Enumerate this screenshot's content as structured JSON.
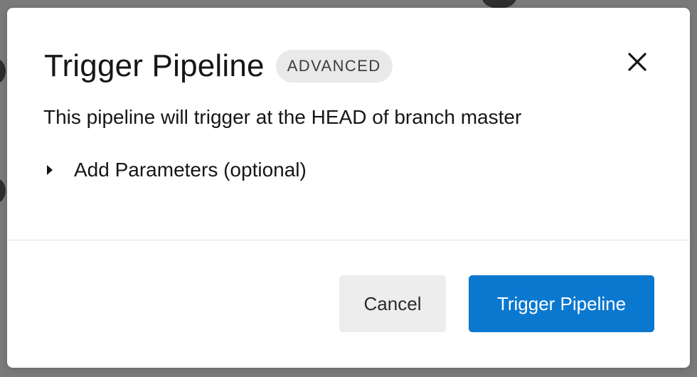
{
  "modal": {
    "title": "Trigger Pipeline",
    "badge": "ADVANCED",
    "description": "This pipeline will trigger at the HEAD of branch master",
    "params_toggle_label": "Add Parameters (optional)",
    "close_icon": "close-icon",
    "caret_icon": "caret-right-icon"
  },
  "footer": {
    "cancel_label": "Cancel",
    "trigger_label": "Trigger Pipeline"
  },
  "colors": {
    "primary": "#0b78d0",
    "badge_bg": "#e9e9e9",
    "overlay": "#7a7a7a"
  }
}
